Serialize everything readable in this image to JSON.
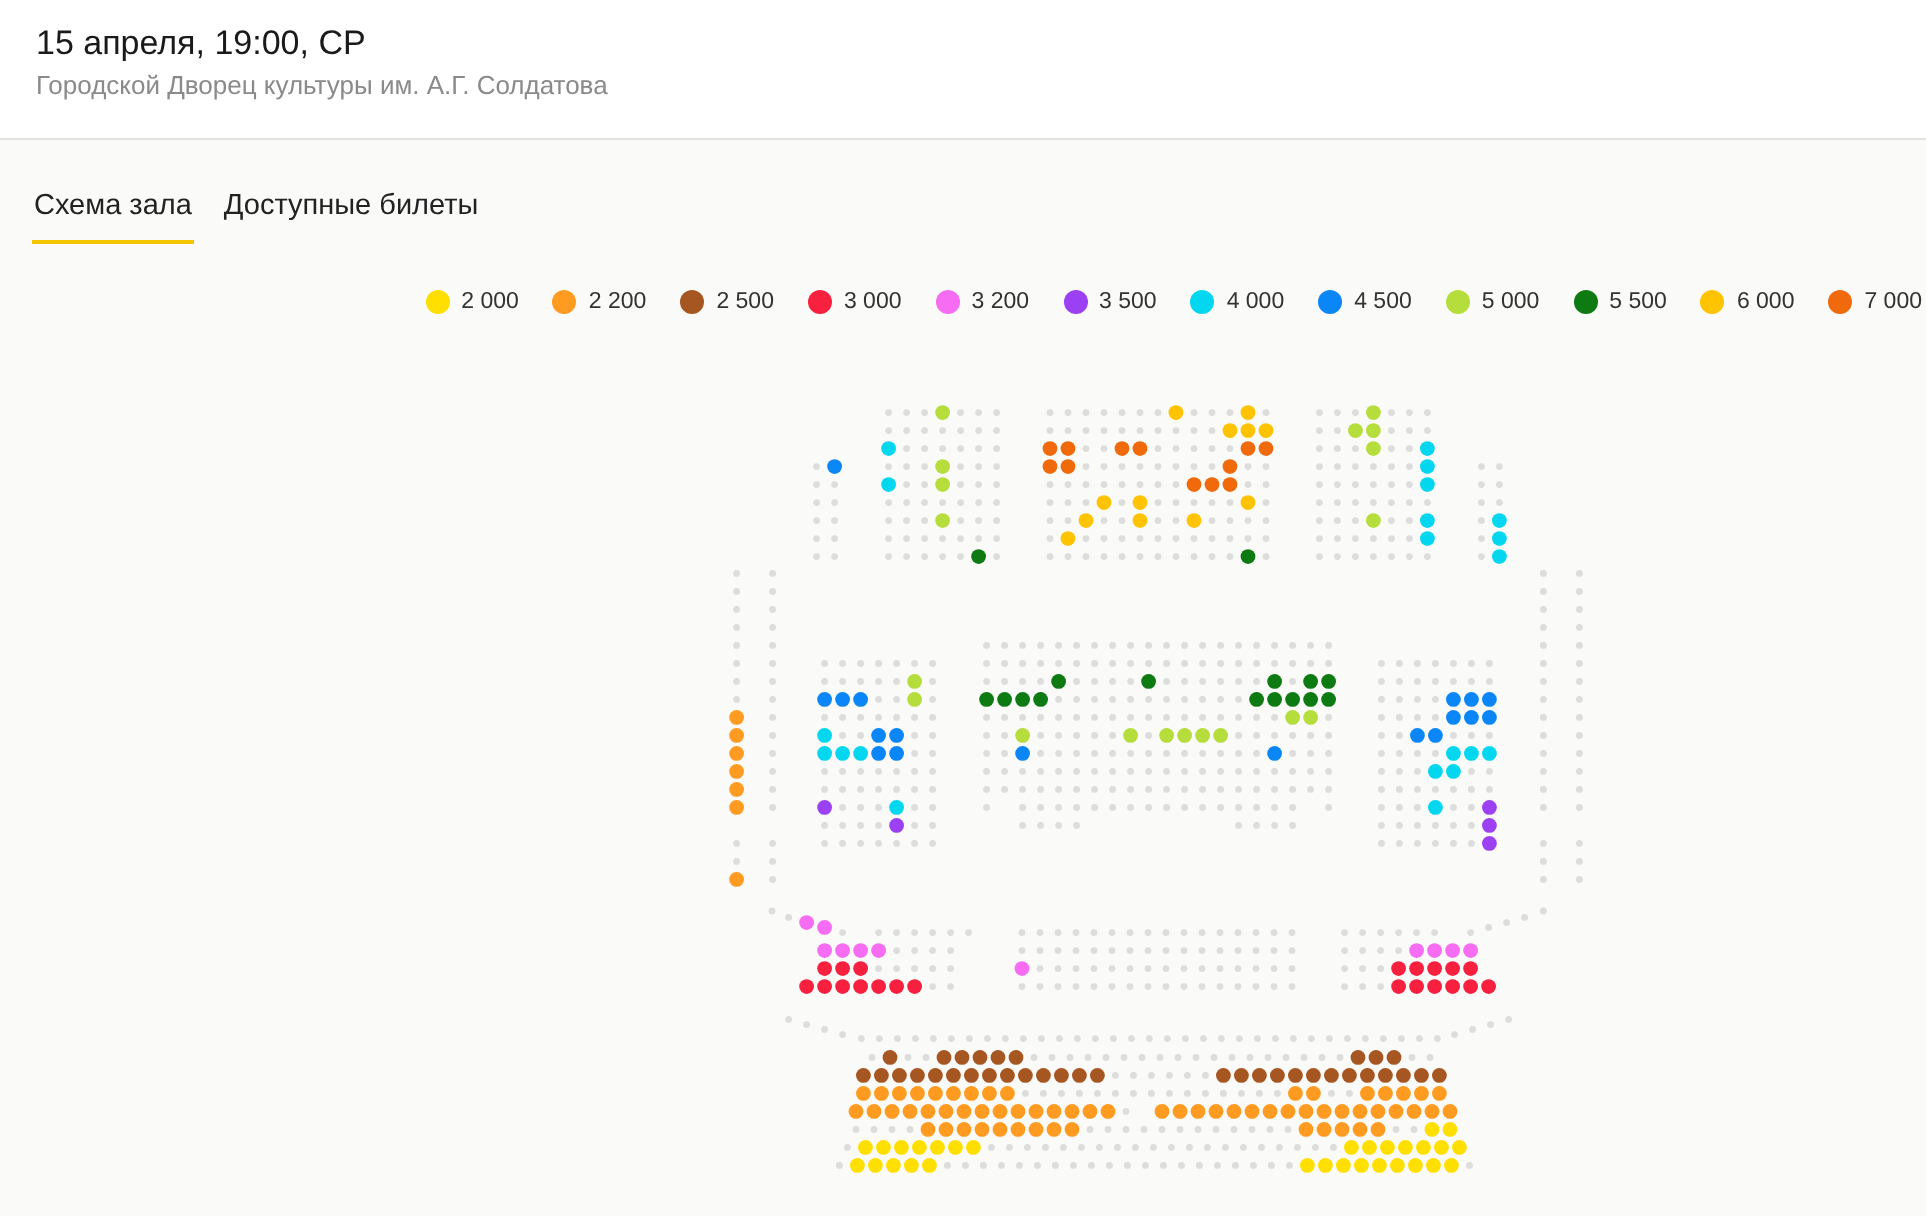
{
  "event": {
    "title": "15 апреля, 19:00, СР",
    "venue": "Городской Дворец культуры им. А.Г. Солдатова"
  },
  "tabs": [
    {
      "label": "Схема зала",
      "selected": true
    },
    {
      "label": "Доступные билеты",
      "selected": false
    }
  ],
  "legend": [
    {
      "price": "2 000",
      "color": "#ffdf00"
    },
    {
      "price": "2 200",
      "color": "#ff9b21"
    },
    {
      "price": "2 500",
      "color": "#a65620"
    },
    {
      "price": "3 000",
      "color": "#f7213f"
    },
    {
      "price": "3 200",
      "color": "#f66cf2"
    },
    {
      "price": "3 500",
      "color": "#9b40f2"
    },
    {
      "price": "4 000",
      "color": "#03d7f0"
    },
    {
      "price": "4 500",
      "color": "#0b86f7"
    },
    {
      "price": "5 000",
      "color": "#b5de3c"
    },
    {
      "price": "5 500",
      "color": "#0e7a12"
    },
    {
      "price": "6 000",
      "color": "#ffc300"
    },
    {
      "price": "7 000",
      "color": "#f06a0c"
    }
  ],
  "seat_map": {
    "sections": [
      {
        "rows": [
          [
            false,
            {
              "color": "#0b86f7"
            }
          ],
          [
            false,
            false
          ],
          [
            false,
            false
          ],
          [
            false,
            false
          ],
          [
            false,
            false
          ],
          [
            false,
            false
          ]
        ]
      },
      {
        "rows": [
          [
            false,
            false,
            false,
            {
              "color": "#b5de3c"
            },
            false,
            false,
            false
          ],
          [
            false,
            false,
            false,
            false,
            false,
            false,
            false
          ],
          [
            {
              "color": "#03d7f0"
            },
            false,
            false,
            false,
            false,
            false,
            false
          ],
          [
            false,
            false,
            false,
            {
              "color": "#b5de3c"
            },
            false,
            false,
            false
          ],
          [
            {
              "color": "#03d7f0"
            },
            false,
            false,
            {
              "color": "#b5de3c"
            },
            false,
            false,
            false
          ],
          [
            false,
            false,
            false,
            false,
            false,
            false,
            false
          ],
          [
            false,
            false,
            false,
            {
              "color": "#b5de3c"
            },
            false,
            false,
            false
          ],
          [
            false,
            false,
            false,
            false,
            false,
            false,
            false
          ],
          [
            false,
            false,
            false,
            false,
            false,
            {
              "color": "#0e7a12"
            },
            false
          ]
        ]
      },
      {
        "rows": [
          [
            false,
            false,
            false,
            false,
            false,
            false,
            false,
            {
              "color": "#ffc300"
            },
            false,
            false,
            false,
            {
              "color": "#ffc300"
            },
            false
          ],
          [
            false,
            false,
            false,
            false,
            false,
            false,
            false,
            false,
            false,
            false,
            {
              "color": "#ffc300"
            },
            {
              "color": "#ffc300"
            },
            {
              "color": "#ffc300"
            }
          ],
          [
            {
              "color": "#f06a0c"
            },
            {
              "color": "#f06a0c"
            },
            false,
            false,
            {
              "color": "#f06a0c"
            },
            {
              "color": "#f06a0c"
            },
            false,
            false,
            false,
            false,
            false,
            {
              "color": "#f06a0c"
            },
            {
              "color": "#f06a0c"
            }
          ],
          [
            {
              "color": "#f06a0c"
            },
            {
              "color": "#f06a0c"
            },
            false,
            false,
            false,
            false,
            false,
            false,
            false,
            false,
            {
              "color": "#f06a0c"
            },
            false,
            false
          ],
          [
            false,
            false,
            false,
            false,
            false,
            false,
            false,
            false,
            {
              "color": "#f06a0c"
            },
            {
              "color": "#f06a0c"
            },
            {
              "color": "#f06a0c"
            },
            false,
            false
          ],
          [
            false,
            false,
            false,
            {
              "color": "#ffc300"
            },
            false,
            {
              "color": "#ffc300"
            },
            false,
            false,
            false,
            false,
            false,
            {
              "color": "#ffc300"
            },
            false
          ],
          [
            false,
            false,
            {
              "color": "#ffc300"
            },
            false,
            false,
            {
              "color": "#ffc300"
            },
            false,
            false,
            {
              "color": "#ffc300"
            },
            false,
            false,
            false,
            false
          ],
          [
            false,
            {
              "color": "#ffc300"
            },
            false,
            false,
            false,
            false,
            false,
            false,
            false,
            false,
            false,
            false,
            false
          ],
          [
            false,
            false,
            false,
            false,
            false,
            false,
            false,
            false,
            false,
            false,
            false,
            {
              "color": "#0e7a12"
            },
            false
          ]
        ]
      },
      {
        "rows": [
          [
            false,
            false,
            false,
            {
              "color": "#b5de3c"
            },
            false,
            false,
            false
          ],
          [
            false,
            false,
            {
              "color": "#b5de3c"
            },
            {
              "color": "#b5de3c"
            },
            false,
            false,
            false
          ],
          [
            false,
            false,
            false,
            {
              "color": "#b5de3c"
            },
            false,
            false,
            {
              "color": "#03d7f0"
            }
          ],
          [
            false,
            false,
            false,
            false,
            false,
            false,
            {
              "color": "#03d7f0"
            }
          ],
          [
            false,
            false,
            false,
            false,
            false,
            false,
            {
              "color": "#03d7f0"
            }
          ],
          [
            false,
            false,
            false,
            false,
            false,
            false,
            false
          ],
          [
            false,
            false,
            false,
            {
              "color": "#b5de3c"
            },
            false,
            false,
            {
              "color": "#03d7f0"
            }
          ],
          [
            false,
            false,
            false,
            false,
            false,
            false,
            {
              "color": "#03d7f0"
            }
          ],
          [
            false,
            false,
            false,
            false,
            false,
            false,
            false
          ]
        ]
      },
      {
        "rows": [
          [
            false,
            false
          ],
          [
            false,
            false
          ],
          [
            false,
            false
          ],
          [
            false,
            {
              "color": "#03d7f0"
            }
          ],
          [
            false,
            {
              "color": "#03d7f0"
            }
          ],
          [
            false,
            {
              "color": "#03d7f0"
            }
          ]
        ]
      },
      {
        "rows": [
          [
            false,
            false
          ],
          [
            false,
            false
          ],
          [
            false,
            false
          ],
          [
            false,
            false
          ],
          [
            false,
            false
          ],
          [
            false,
            false
          ],
          [
            false,
            false
          ],
          [
            false,
            false
          ],
          [
            {
              "color": "#ff9b21"
            },
            false
          ],
          [
            {
              "color": "#ff9b21"
            },
            false
          ],
          [
            {
              "color": "#ff9b21"
            },
            false
          ],
          [
            {
              "color": "#ff9b21"
            },
            false
          ],
          [
            {
              "color": "#ff9b21"
            },
            false
          ],
          [
            {
              "color": "#ff9b21"
            },
            false
          ],
          [
            false,
            false
          ],
          [
            false,
            false
          ],
          [
            {
              "color": "#ff9b21"
            },
            false
          ]
        ]
      },
      {
        "rows": [
          [
            false,
            false,
            false,
            false,
            false,
            false,
            false
          ],
          [
            false,
            false,
            false,
            false,
            false,
            {
              "color": "#b5de3c"
            },
            false
          ],
          [
            {
              "color": "#0b86f7"
            },
            {
              "color": "#0b86f7"
            },
            {
              "color": "#0b86f7"
            },
            false,
            false,
            {
              "color": "#b5de3c"
            },
            false
          ],
          [
            false,
            false,
            false,
            false,
            false,
            false,
            false
          ],
          [
            {
              "color": "#03d7f0"
            },
            false,
            false,
            {
              "color": "#0b86f7"
            },
            {
              "color": "#0b86f7"
            },
            false,
            false
          ],
          [
            {
              "color": "#03d7f0"
            },
            {
              "color": "#03d7f0"
            },
            {
              "color": "#03d7f0"
            },
            {
              "color": "#0b86f7"
            },
            {
              "color": "#0b86f7"
            },
            false,
            false
          ],
          [
            false,
            false,
            false,
            false,
            false,
            false,
            false
          ],
          [
            false,
            false,
            false,
            false,
            false,
            false,
            false
          ],
          [
            {
              "color": "#9b40f2"
            },
            false,
            false,
            false,
            {
              "color": "#03d7f0"
            },
            false,
            false
          ],
          [
            false,
            false,
            false,
            false,
            {
              "color": "#9b40f2"
            },
            false,
            false
          ],
          [
            false,
            false,
            false,
            false,
            false,
            false,
            false
          ]
        ]
      },
      {
        "rows": [
          [
            false,
            false,
            false,
            false,
            false,
            false,
            false,
            false,
            false,
            false,
            false,
            false,
            false,
            false,
            false,
            false,
            false,
            false,
            false,
            false
          ],
          [
            false,
            false,
            false,
            false,
            false,
            false,
            false,
            false,
            false,
            false,
            false,
            false,
            false,
            false,
            false,
            false,
            false,
            false,
            false,
            false
          ],
          [
            false,
            false,
            false,
            false,
            {
              "color": "#0e7a12"
            },
            false,
            false,
            false,
            false,
            {
              "color": "#0e7a12"
            },
            false,
            false,
            false,
            false,
            false,
            false,
            {
              "color": "#0e7a12"
            },
            false,
            {
              "color": "#0e7a12"
            },
            {
              "color": "#0e7a12"
            }
          ],
          [
            {
              "color": "#0e7a12"
            },
            {
              "color": "#0e7a12"
            },
            {
              "color": "#0e7a12"
            },
            {
              "color": "#0e7a12"
            },
            false,
            false,
            false,
            false,
            false,
            false,
            false,
            false,
            false,
            false,
            false,
            {
              "color": "#0e7a12"
            },
            {
              "color": "#0e7a12"
            },
            {
              "color": "#0e7a12"
            },
            {
              "color": "#0e7a12"
            },
            {
              "color": "#0e7a12"
            }
          ],
          [
            false,
            false,
            false,
            false,
            false,
            false,
            false,
            false,
            false,
            false,
            false,
            false,
            false,
            false,
            false,
            false,
            false,
            {
              "color": "#b5de3c"
            },
            {
              "color": "#b5de3c"
            },
            false
          ],
          [
            false,
            false,
            {
              "color": "#b5de3c"
            },
            false,
            false,
            false,
            false,
            false,
            {
              "color": "#b5de3c"
            },
            false,
            {
              "color": "#b5de3c"
            },
            {
              "color": "#b5de3c"
            },
            {
              "color": "#b5de3c"
            },
            {
              "color": "#b5de3c"
            },
            false,
            false,
            false,
            false,
            false,
            false
          ],
          [
            false,
            false,
            {
              "color": "#0b86f7"
            },
            false,
            false,
            false,
            false,
            false,
            false,
            false,
            false,
            false,
            false,
            false,
            false,
            false,
            {
              "color": "#0b86f7"
            },
            false,
            false,
            false
          ],
          [
            false,
            false,
            false,
            false,
            false,
            false,
            false,
            false,
            false,
            false,
            false,
            false,
            false,
            false,
            false,
            false,
            false,
            false,
            false,
            false
          ],
          [
            false,
            false,
            false,
            false,
            false,
            false,
            false,
            false,
            false,
            false,
            false,
            false,
            false,
            false,
            false,
            false,
            false,
            false,
            false,
            false
          ],
          [
            false,
            false,
            false,
            false,
            false,
            false,
            false,
            false,
            false,
            false,
            false,
            false,
            false,
            false,
            false,
            false,
            false,
            false
          ],
          [
            false,
            false,
            false,
            false,
            false,
            false,
            false,
            false
          ]
        ]
      },
      {
        "rows": [
          [
            false,
            false,
            false,
            false,
            false,
            false,
            false
          ],
          [
            false,
            false,
            false,
            false,
            false,
            false,
            false
          ],
          [
            false,
            false,
            false,
            false,
            {
              "color": "#0b86f7"
            },
            {
              "color": "#0b86f7"
            },
            {
              "color": "#0b86f7"
            }
          ],
          [
            false,
            false,
            false,
            false,
            {
              "color": "#0b86f7"
            },
            {
              "color": "#0b86f7"
            },
            {
              "color": "#0b86f7"
            }
          ],
          [
            false,
            false,
            {
              "color": "#0b86f7"
            },
            {
              "color": "#0b86f7"
            },
            false,
            false,
            false
          ],
          [
            false,
            false,
            false,
            false,
            {
              "color": "#03d7f0"
            },
            {
              "color": "#03d7f0"
            },
            {
              "color": "#03d7f0"
            }
          ],
          [
            false,
            false,
            false,
            {
              "color": "#03d7f0"
            },
            {
              "color": "#03d7f0"
            },
            false,
            false
          ],
          [
            false,
            false,
            false,
            false,
            false,
            false,
            false
          ],
          [
            false,
            false,
            false,
            {
              "color": "#03d7f0"
            },
            false,
            false,
            {
              "color": "#9b40f2"
            }
          ],
          [
            false,
            false,
            false,
            false,
            false,
            false,
            {
              "color": "#9b40f2"
            }
          ],
          [
            false,
            false,
            false,
            false,
            false,
            false,
            {
              "color": "#9b40f2"
            }
          ]
        ]
      },
      {
        "rows": [
          [
            false,
            false
          ],
          [
            false,
            false
          ],
          [
            false,
            false
          ],
          [
            false,
            false
          ],
          [
            false,
            false
          ],
          [
            false,
            false
          ],
          [
            false,
            false
          ],
          [
            false,
            false
          ],
          [
            false,
            false
          ],
          [
            false,
            false
          ],
          [
            false,
            false
          ],
          [
            false,
            false
          ],
          [
            false,
            false
          ],
          [
            false,
            false
          ],
          [
            false,
            false
          ],
          [
            false,
            false
          ],
          [
            false,
            false
          ]
        ]
      },
      {
        "rows": [
          [
            false,
            false,
            {
              "color": "#f66cf2"
            },
            {
              "color": "#f66cf2"
            }
          ]
        ]
      },
      {
        "rows": [
          [
            false,
            false,
            false,
            false
          ]
        ]
      },
      {
        "rows": [
          [
            false,
            false,
            false,
            false,
            false,
            false,
            false
          ],
          [
            {
              "color": "#f66cf2"
            },
            {
              "color": "#f66cf2"
            },
            {
              "color": "#f66cf2"
            },
            {
              "color": "#f66cf2"
            },
            false,
            false,
            false,
            false
          ],
          [
            {
              "color": "#f7213f"
            },
            {
              "color": "#f7213f"
            },
            {
              "color": "#f7213f"
            },
            false,
            false,
            false,
            false,
            false
          ],
          [
            {
              "color": "#f7213f"
            },
            {
              "color": "#f7213f"
            },
            {
              "color": "#f7213f"
            },
            {
              "color": "#f7213f"
            },
            {
              "color": "#f7213f"
            },
            {
              "color": "#f7213f"
            },
            {
              "color": "#f7213f"
            },
            false,
            false
          ]
        ]
      },
      {
        "rows": [
          [
            false,
            false,
            false,
            false,
            false,
            false,
            false,
            false,
            false,
            false,
            false,
            false,
            false,
            false,
            false,
            false
          ],
          [
            false,
            false,
            false,
            false,
            false,
            false,
            false,
            false,
            false,
            false,
            false,
            false,
            false,
            false,
            false,
            false
          ],
          [
            {
              "color": "#f66cf2"
            },
            false,
            false,
            false,
            false,
            false,
            false,
            false,
            false,
            false,
            false,
            false,
            false,
            false,
            false,
            false
          ],
          [
            false,
            false,
            false,
            false,
            false,
            false,
            false,
            false,
            false,
            false,
            false,
            false,
            false,
            false,
            false,
            false
          ]
        ]
      },
      {
        "rows": [
          [
            false,
            false,
            false,
            false,
            false,
            false,
            false
          ],
          [
            false,
            false,
            false,
            false,
            {
              "color": "#f66cf2"
            },
            {
              "color": "#f66cf2"
            },
            {
              "color": "#f66cf2"
            },
            {
              "color": "#f66cf2"
            }
          ],
          [
            false,
            false,
            false,
            {
              "color": "#f7213f"
            },
            {
              "color": "#f7213f"
            },
            {
              "color": "#f7213f"
            },
            {
              "color": "#f7213f"
            },
            {
              "color": "#f7213f"
            }
          ],
          [
            false,
            false,
            false,
            {
              "color": "#f7213f"
            },
            {
              "color": "#f7213f"
            },
            {
              "color": "#f7213f"
            },
            {
              "color": "#f7213f"
            },
            {
              "color": "#f7213f"
            },
            {
              "color": "#f7213f"
            }
          ]
        ]
      },
      {
        "rows": [
          [
            false,
            false,
            false,
            false,
            false,
            false,
            false,
            false,
            false,
            false,
            false,
            false,
            false,
            false,
            false,
            false,
            false,
            false,
            false,
            false,
            false,
            false,
            false,
            false,
            false,
            false,
            false,
            false,
            false,
            false,
            false,
            false,
            false,
            false,
            false,
            false,
            false,
            false,
            false,
            false,
            false
          ]
        ]
      },
      {
        "rows": [
          [
            false,
            {
              "color": "#a65620"
            },
            false,
            false,
            {
              "color": "#a65620"
            },
            {
              "color": "#a65620"
            },
            {
              "color": "#a65620"
            },
            {
              "color": "#a65620"
            },
            {
              "color": "#a65620"
            },
            false,
            false,
            false,
            false,
            false,
            false,
            false,
            false,
            false,
            false,
            false,
            false,
            false,
            false,
            false,
            false,
            false,
            false,
            {
              "color": "#a65620"
            },
            {
              "color": "#a65620"
            },
            {
              "color": "#a65620"
            },
            false,
            false
          ],
          [
            {
              "color": "#a65620"
            },
            {
              "color": "#a65620"
            },
            {
              "color": "#a65620"
            },
            {
              "color": "#a65620"
            },
            {
              "color": "#a65620"
            },
            {
              "color": "#a65620"
            },
            {
              "color": "#a65620"
            },
            {
              "color": "#a65620"
            },
            {
              "color": "#a65620"
            },
            {
              "color": "#a65620"
            },
            {
              "color": "#a65620"
            },
            {
              "color": "#a65620"
            },
            {
              "color": "#a65620"
            },
            {
              "color": "#a65620"
            },
            false,
            false,
            false,
            false,
            false,
            false,
            {
              "color": "#a65620"
            },
            {
              "color": "#a65620"
            },
            {
              "color": "#a65620"
            },
            {
              "color": "#a65620"
            },
            {
              "color": "#a65620"
            },
            {
              "color": "#a65620"
            },
            {
              "color": "#a65620"
            },
            {
              "color": "#a65620"
            },
            {
              "color": "#a65620"
            },
            {
              "color": "#a65620"
            },
            {
              "color": "#a65620"
            },
            {
              "color": "#a65620"
            },
            {
              "color": "#a65620"
            }
          ],
          [
            {
              "color": "#ff9b21"
            },
            {
              "color": "#ff9b21"
            },
            {
              "color": "#ff9b21"
            },
            {
              "color": "#ff9b21"
            },
            {
              "color": "#ff9b21"
            },
            {
              "color": "#ff9b21"
            },
            {
              "color": "#ff9b21"
            },
            {
              "color": "#ff9b21"
            },
            {
              "color": "#ff9b21"
            },
            false,
            false,
            false,
            false,
            false,
            false,
            false,
            false,
            false,
            false,
            false,
            false,
            false,
            false,
            false,
            {
              "color": "#ff9b21"
            },
            {
              "color": "#ff9b21"
            },
            false,
            false,
            {
              "color": "#ff9b21"
            },
            {
              "color": "#ff9b21"
            },
            {
              "color": "#ff9b21"
            },
            {
              "color": "#ff9b21"
            },
            {
              "color": "#ff9b21"
            }
          ],
          [
            {
              "color": "#ff9b21"
            },
            {
              "color": "#ff9b21"
            },
            {
              "color": "#ff9b21"
            },
            {
              "color": "#ff9b21"
            },
            {
              "color": "#ff9b21"
            },
            {
              "color": "#ff9b21"
            },
            {
              "color": "#ff9b21"
            },
            {
              "color": "#ff9b21"
            },
            {
              "color": "#ff9b21"
            },
            {
              "color": "#ff9b21"
            },
            {
              "color": "#ff9b21"
            },
            {
              "color": "#ff9b21"
            },
            {
              "color": "#ff9b21"
            },
            {
              "color": "#ff9b21"
            },
            {
              "color": "#ff9b21"
            },
            false,
            {
              "color": "#ff9b21"
            },
            {
              "color": "#ff9b21"
            },
            {
              "color": "#ff9b21"
            },
            {
              "color": "#ff9b21"
            },
            {
              "color": "#ff9b21"
            },
            {
              "color": "#ff9b21"
            },
            {
              "color": "#ff9b21"
            },
            {
              "color": "#ff9b21"
            },
            {
              "color": "#ff9b21"
            },
            {
              "color": "#ff9b21"
            },
            {
              "color": "#ff9b21"
            },
            {
              "color": "#ff9b21"
            },
            {
              "color": "#ff9b21"
            },
            {
              "color": "#ff9b21"
            },
            {
              "color": "#ff9b21"
            },
            {
              "color": "#ff9b21"
            },
            {
              "color": "#ff9b21"
            }
          ],
          [
            false,
            false,
            false,
            false,
            {
              "color": "#ff9b21"
            },
            {
              "color": "#ff9b21"
            },
            {
              "color": "#ff9b21"
            },
            {
              "color": "#ff9b21"
            },
            {
              "color": "#ff9b21"
            },
            {
              "color": "#ff9b21"
            },
            {
              "color": "#ff9b21"
            },
            {
              "color": "#ff9b21"
            },
            {
              "color": "#ff9b21"
            },
            false,
            false,
            false,
            false,
            false,
            false,
            false,
            false,
            false,
            false,
            false,
            false,
            {
              "color": "#ff9b21"
            },
            {
              "color": "#ff9b21"
            },
            {
              "color": "#ff9b21"
            },
            {
              "color": "#ff9b21"
            },
            {
              "color": "#ff9b21"
            },
            false,
            false,
            {
              "color": "#ffdf00"
            },
            {
              "color": "#ffdf00"
            }
          ],
          [
            false,
            {
              "color": "#ffdf00"
            },
            {
              "color": "#ffdf00"
            },
            {
              "color": "#ffdf00"
            },
            {
              "color": "#ffdf00"
            },
            {
              "color": "#ffdf00"
            },
            {
              "color": "#ffdf00"
            },
            {
              "color": "#ffdf00"
            },
            false,
            false,
            false,
            false,
            false,
            false,
            false,
            false,
            false,
            false,
            false,
            false,
            false,
            false,
            false,
            false,
            false,
            false,
            false,
            false,
            {
              "color": "#ffdf00"
            },
            {
              "color": "#ffdf00"
            },
            {
              "color": "#ffdf00"
            },
            {
              "color": "#ffdf00"
            },
            {
              "color": "#ffdf00"
            },
            {
              "color": "#ffdf00"
            },
            {
              "color": "#ffdf00"
            }
          ],
          [
            false,
            {
              "color": "#ffdf00"
            },
            {
              "color": "#ffdf00"
            },
            {
              "color": "#ffdf00"
            },
            {
              "color": "#ffdf00"
            },
            {
              "color": "#ffdf00"
            },
            false,
            false,
            false,
            false,
            false,
            false,
            false,
            false,
            false,
            false,
            false,
            false,
            false,
            false,
            false,
            false,
            false,
            false,
            false,
            false,
            {
              "color": "#ffdf00"
            },
            {
              "color": "#ffdf00"
            },
            {
              "color": "#ffdf00"
            },
            {
              "color": "#ffdf00"
            },
            {
              "color": "#ffdf00"
            },
            {
              "color": "#ffdf00"
            },
            {
              "color": "#ffdf00"
            },
            {
              "color": "#ffdf00"
            },
            {
              "color": "#ffdf00"
            },
            false
          ]
        ]
      }
    ]
  }
}
